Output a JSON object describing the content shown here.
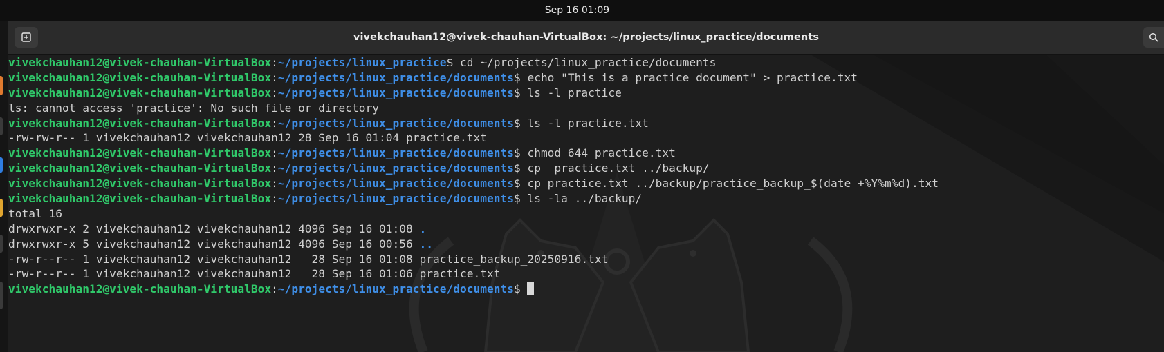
{
  "topbar": {
    "datetime": "Sep 16  01:09"
  },
  "window": {
    "title": "vivekchauhan12@vivek-chauhan-VirtualBox: ~/projects/linux_practice/documents"
  },
  "icons": {
    "new_tab": "new-tab-icon",
    "search": "search-icon"
  },
  "colors": {
    "prompt_user": "#30c96a",
    "prompt_path": "#3f8fe8",
    "output_text": "#d0d0d0",
    "background": "#1e1e1e"
  },
  "terminal": {
    "prompt_user": "vivekchauhan12@vivek-chauhan-VirtualBox",
    "prompt_sep": ":",
    "prompt_suffix": "$",
    "lines": [
      {
        "type": "prompt",
        "path": "~/projects/linux_practice",
        "command": " cd ~/projects/linux_practice/documents"
      },
      {
        "type": "prompt",
        "path": "~/projects/linux_practice/documents",
        "command": " echo \"This is a practice document\" > practice.txt"
      },
      {
        "type": "prompt",
        "path": "~/projects/linux_practice/documents",
        "command": " ls -l practice"
      },
      {
        "type": "output",
        "text": "ls: cannot access 'practice': No such file or directory"
      },
      {
        "type": "prompt",
        "path": "~/projects/linux_practice/documents",
        "command": " ls -l practice.txt"
      },
      {
        "type": "output",
        "text": "-rw-rw-r-- 1 vivekchauhan12 vivekchauhan12 28 Sep 16 01:04 practice.txt"
      },
      {
        "type": "prompt",
        "path": "~/projects/linux_practice/documents",
        "command": " chmod 644 practice.txt"
      },
      {
        "type": "prompt",
        "path": "~/projects/linux_practice/documents",
        "command": " cp  practice.txt ../backup/"
      },
      {
        "type": "prompt",
        "path": "~/projects/linux_practice/documents",
        "command": " cp practice.txt ../backup/practice_backup_$(date +%Y%m%d).txt"
      },
      {
        "type": "prompt",
        "path": "~/projects/linux_practice/documents",
        "command": " ls -la ../backup/"
      },
      {
        "type": "output",
        "text": "total 16"
      },
      {
        "type": "listing",
        "text": "drwxrwxr-x 2 vivekchauhan12 vivekchauhan12 4096 Sep 16 01:08 ",
        "name": "."
      },
      {
        "type": "listing",
        "text": "drwxrwxr-x 5 vivekchauhan12 vivekchauhan12 4096 Sep 16 00:56 ",
        "name": ".."
      },
      {
        "type": "output",
        "text": "-rw-r--r-- 1 vivekchauhan12 vivekchauhan12   28 Sep 16 01:08 practice_backup_20250916.txt"
      },
      {
        "type": "output",
        "text": "-rw-r--r-- 1 vivekchauhan12 vivekchauhan12   28 Sep 16 01:06 practice.txt"
      },
      {
        "type": "prompt",
        "path": "~/projects/linux_practice/documents",
        "command": " ",
        "cursor": true
      }
    ]
  }
}
